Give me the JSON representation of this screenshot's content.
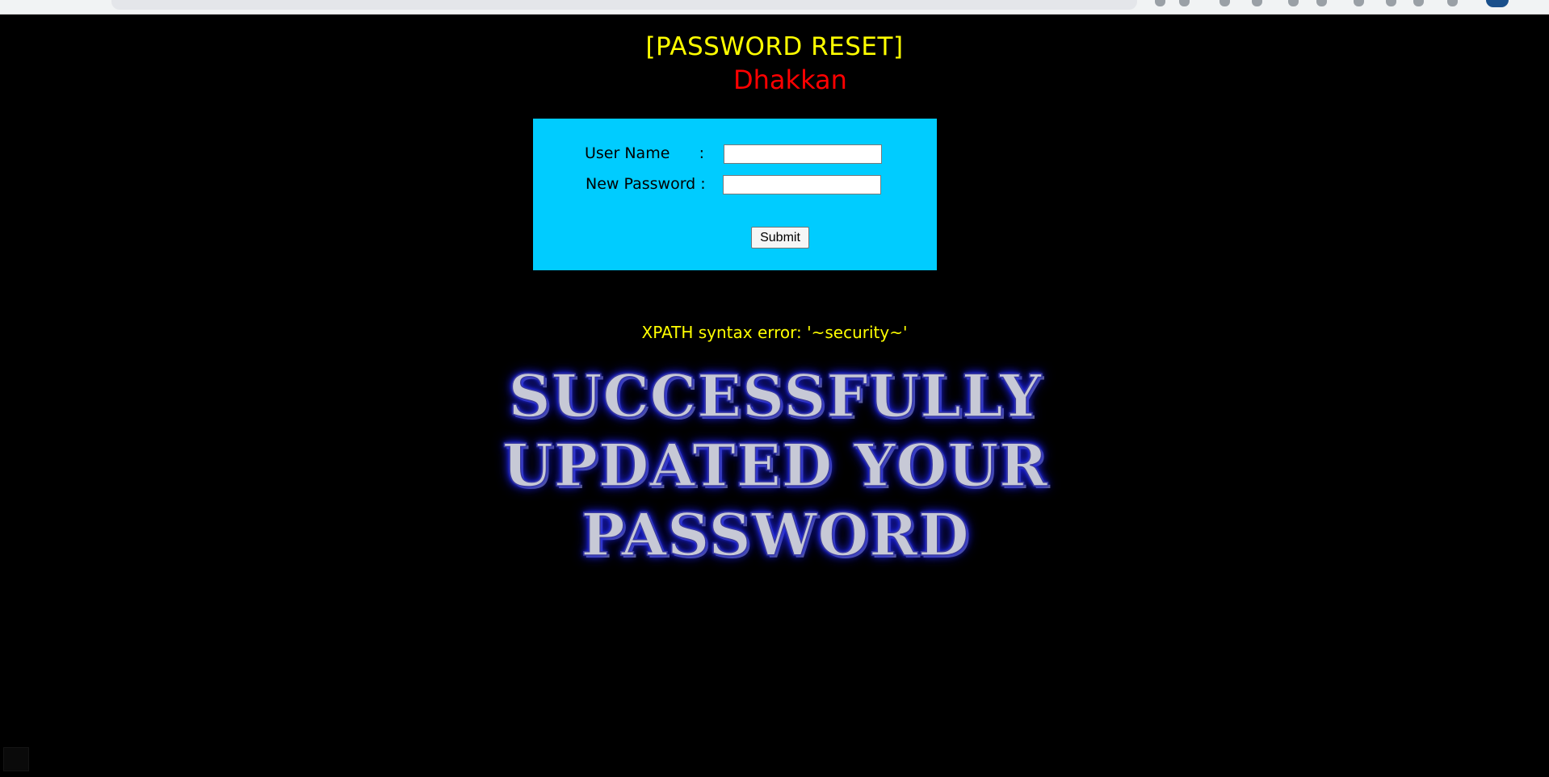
{
  "page": {
    "title": "[PASSWORD RESET]",
    "subtitle": "Dhakkan"
  },
  "form": {
    "username_label": "User Name      :",
    "username_value": "",
    "password_label": "New Password :",
    "password_value": "",
    "submit_label": "Submit"
  },
  "error": {
    "message": "XPATH syntax error: '~security~'"
  },
  "banner": {
    "line1": "SUCCESSFULLY",
    "line2": "UPDATED YOUR",
    "line3": "PASSWORD"
  },
  "colors": {
    "background": "#000000",
    "title": "#ffff00",
    "subtitle": "#ff0000",
    "form_box": "#00ccff",
    "error": "#ffff00"
  }
}
